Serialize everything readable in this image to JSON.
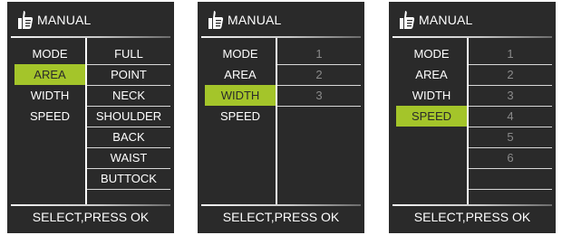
{
  "screens": [
    {
      "title": "MANUAL",
      "left_items": [
        {
          "label": "MODE",
          "selected": false
        },
        {
          "label": "AREA",
          "selected": true
        },
        {
          "label": "WIDTH",
          "selected": false
        },
        {
          "label": "SPEED",
          "selected": false
        }
      ],
      "right_items": [
        "FULL",
        "POINT",
        "NECK",
        "SHOULDER",
        "BACK",
        "WAIST",
        "BUTTOCK"
      ],
      "right_style": "bright",
      "footer": "SELECT,PRESS OK"
    },
    {
      "title": "MANUAL",
      "left_items": [
        {
          "label": "MODE",
          "selected": false
        },
        {
          "label": "AREA",
          "selected": false
        },
        {
          "label": "WIDTH",
          "selected": true
        },
        {
          "label": "SPEED",
          "selected": false
        }
      ],
      "right_items": [
        "1",
        "2",
        "3"
      ],
      "right_style": "dim",
      "footer": "SELECT,PRESS OK"
    },
    {
      "title": "MANUAL",
      "left_items": [
        {
          "label": "MODE",
          "selected": false
        },
        {
          "label": "AREA",
          "selected": false
        },
        {
          "label": "WIDTH",
          "selected": false
        },
        {
          "label": "SPEED",
          "selected": true
        }
      ],
      "right_items": [
        "1",
        "2",
        "3",
        "4",
        "5",
        "6"
      ],
      "right_style": "dim",
      "footer": "SELECT,PRESS OK"
    }
  ],
  "colors": {
    "background": "#2a2a2a",
    "selection": "#a4c52a",
    "text": "#ffffff",
    "dim_text": "#8a8a8a"
  },
  "icons": {
    "header": "thumbs-up-icon"
  }
}
